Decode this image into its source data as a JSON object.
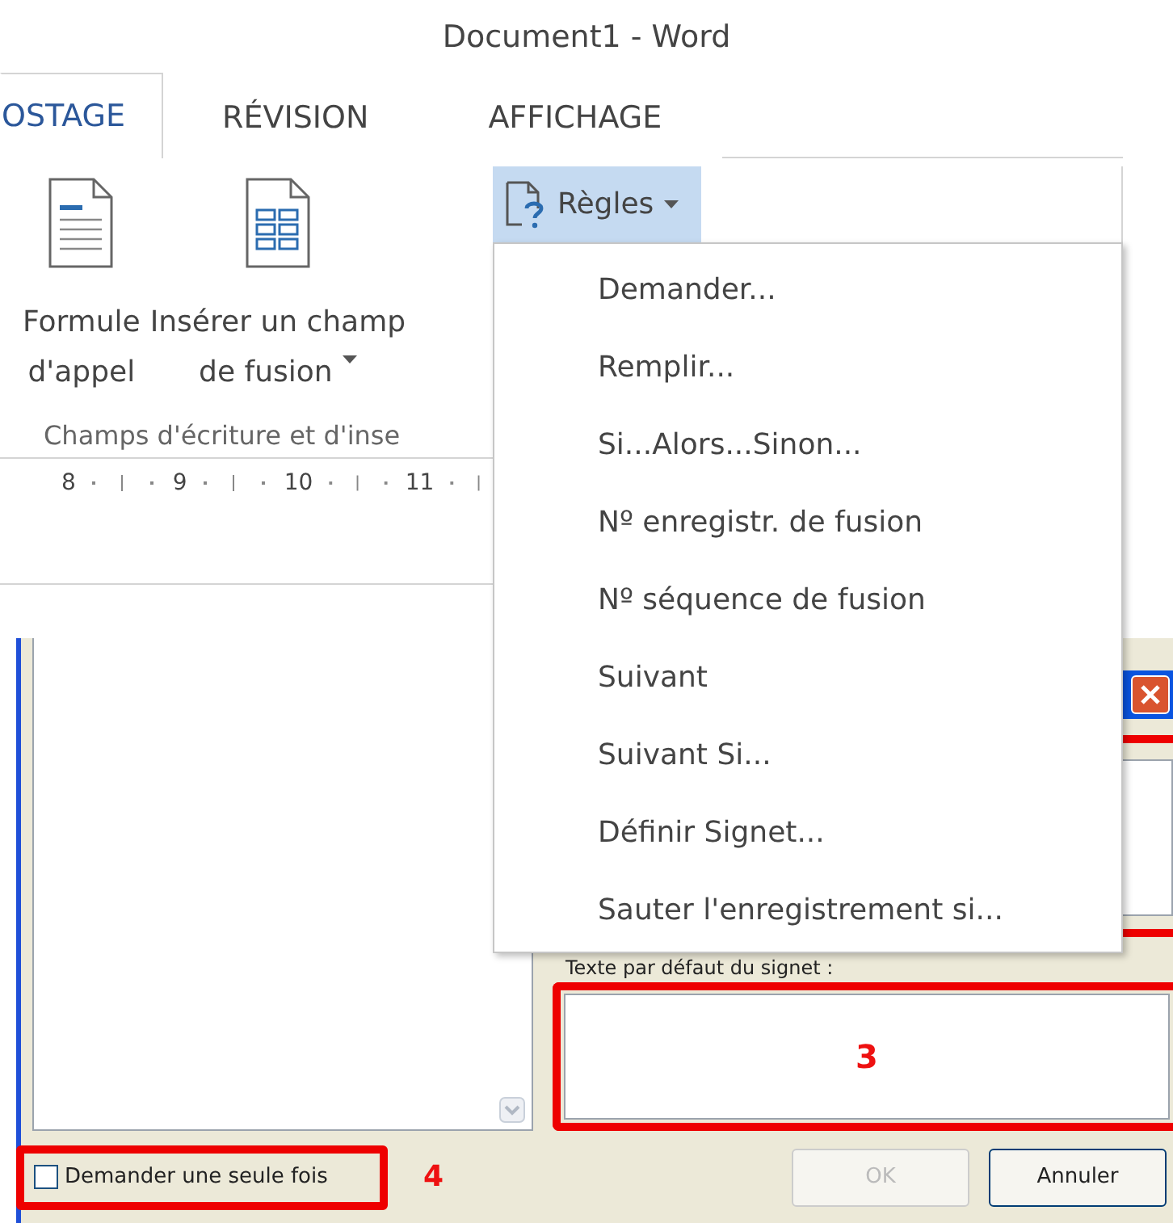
{
  "window": {
    "title": "Document1 - Word"
  },
  "tabs": [
    {
      "label": "OSTAGE",
      "selected": true
    },
    {
      "label": "RÉVISION",
      "selected": false
    },
    {
      "label": "AFFICHAGE",
      "selected": false
    }
  ],
  "ribbon": {
    "buttons": [
      {
        "kind": "letter",
        "lines": [
          "Formule",
          "d'appel"
        ],
        "dropdown": false
      },
      {
        "kind": "field",
        "lines": [
          "Insérer un champ",
          "de fusion"
        ],
        "dropdown": true
      }
    ],
    "group_label": "Champs d'écriture et d'inse",
    "rules_button": {
      "label": "Règles",
      "selected": true
    }
  },
  "ruler": {
    "labels": [
      "8",
      "9",
      "10",
      "11"
    ]
  },
  "rules_menu": {
    "items": [
      {
        "label": "Demander..."
      },
      {
        "label": "Remplir..."
      },
      {
        "label": "Si...Alors...Sinon..."
      },
      {
        "label": "Nº enregistr. de fusion"
      },
      {
        "label": "Nº séquence de fusion"
      },
      {
        "label": "Suivant"
      },
      {
        "label": "Suivant Si..."
      },
      {
        "label": "Définir Signet..."
      },
      {
        "label": "Sauter l'enregistrement si..."
      }
    ]
  },
  "dialog": {
    "default_text_label": "Texte par défaut du signet :",
    "default_text_callout": "3",
    "ask_once": {
      "label": "Demander une seule fois",
      "checked": false
    },
    "ask_once_callout": "4",
    "buttons": [
      {
        "label": "OK",
        "disabled": true
      },
      {
        "label": "Annuler",
        "disabled": false
      }
    ]
  }
}
